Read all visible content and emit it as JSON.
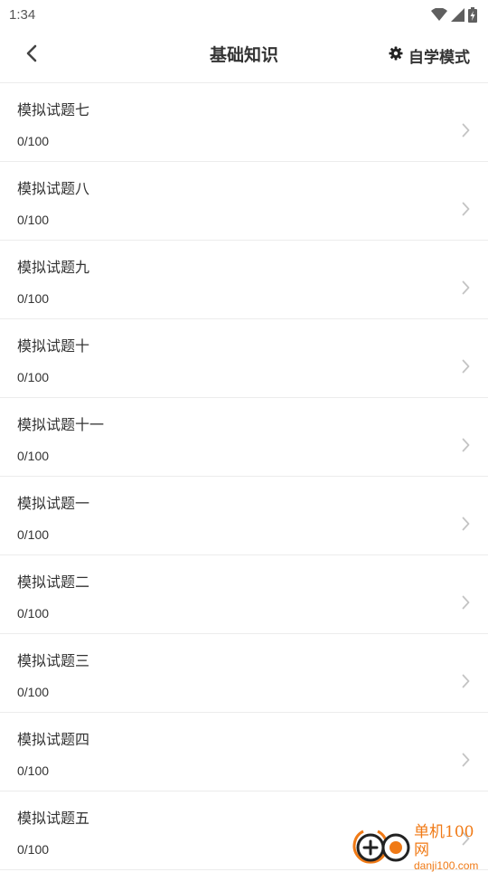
{
  "status_bar": {
    "time": "1:34",
    "icons": [
      "wifi-icon",
      "signal-icon",
      "battery-icon"
    ]
  },
  "header": {
    "title": "基础知识",
    "back_icon": "chevron-left-icon",
    "mode_icon": "gear-icon",
    "mode_label": "自学模式"
  },
  "exams": [
    {
      "title": "模拟试题七",
      "score": "0/100"
    },
    {
      "title": "模拟试题八",
      "score": "0/100"
    },
    {
      "title": "模拟试题九",
      "score": "0/100"
    },
    {
      "title": "模拟试题十",
      "score": "0/100"
    },
    {
      "title": "模拟试题十一",
      "score": "0/100"
    },
    {
      "title": "模拟试题一",
      "score": "0/100"
    },
    {
      "title": "模拟试题二",
      "score": "0/100"
    },
    {
      "title": "模拟试题三",
      "score": "0/100"
    },
    {
      "title": "模拟试题四",
      "score": "0/100"
    },
    {
      "title": "模拟试题五",
      "score": "0/100"
    }
  ],
  "watermark": {
    "name": "单机100网",
    "url": "danji100.com"
  },
  "colors": {
    "text": "#333333",
    "divider": "#ececec",
    "chevron": "#c4c4c4",
    "watermark": "#f07a16"
  }
}
